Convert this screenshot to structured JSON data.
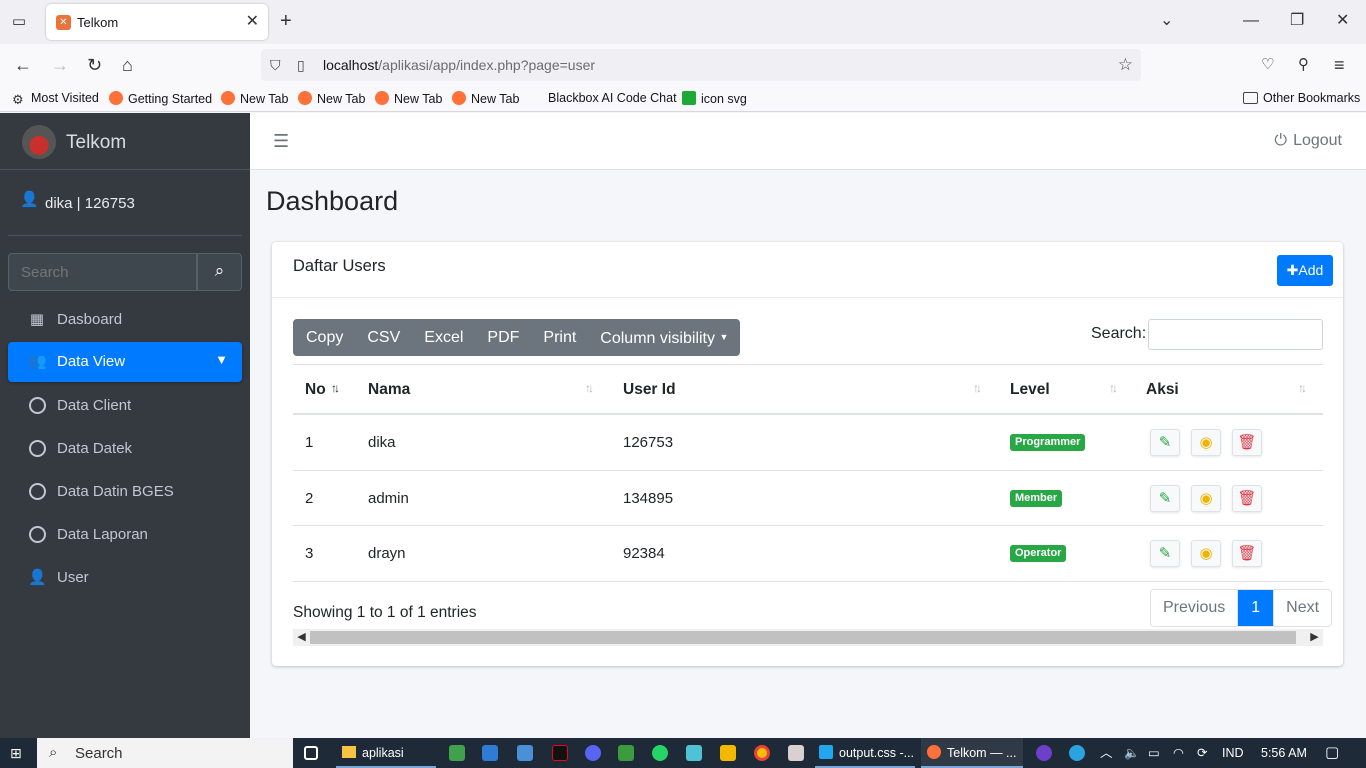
{
  "browser": {
    "tab_title": "Telkom",
    "url_host": "localhost",
    "url_path": "/aplikasi/app/index.php?page=user",
    "bookmarks": [
      "Most Visited",
      "Getting Started",
      "New Tab",
      "New Tab",
      "New Tab",
      "New Tab",
      "Blackbox AI Code Chat",
      "icon svg"
    ],
    "other_bookmarks": "Other Bookmarks"
  },
  "sidebar": {
    "brand": "Telkom",
    "user": "dika | 126753",
    "search_placeholder": "Search",
    "items": [
      {
        "label": "Dasboard",
        "icon": "grid-icon"
      },
      {
        "label": "Data View",
        "icon": "users-icon",
        "active": true
      },
      {
        "label": "Data Client",
        "icon": "circle-icon"
      },
      {
        "label": "Data Datek",
        "icon": "circle-icon"
      },
      {
        "label": "Data Datin BGES",
        "icon": "circle-icon"
      },
      {
        "label": "Data Laporan",
        "icon": "circle-icon"
      },
      {
        "label": "User",
        "icon": "user-icon"
      }
    ]
  },
  "topnav": {
    "logout": "Logout"
  },
  "page": {
    "title": "Dashboard"
  },
  "card": {
    "title": "Daftar Users",
    "add_label": "Add",
    "buttons": [
      "Copy",
      "CSV",
      "Excel",
      "PDF",
      "Print",
      "Column visibility"
    ],
    "search_label": "Search:",
    "columns": [
      "No",
      "Nama",
      "User Id",
      "Level",
      "Aksi"
    ],
    "rows": [
      {
        "no": "1",
        "nama": "dika",
        "user_id": "126753",
        "level": "Programmer"
      },
      {
        "no": "2",
        "nama": "admin",
        "user_id": "134895",
        "level": "Member"
      },
      {
        "no": "3",
        "nama": "drayn",
        "user_id": "92384",
        "level": "Operator"
      }
    ],
    "info": "Showing 1 to 1 of 1 entries",
    "pagination": {
      "previous": "Previous",
      "current": "1",
      "next": "Next"
    }
  },
  "taskbar": {
    "search": "Search",
    "items": [
      "aplikasi",
      "output.css -...",
      "Telkom — ..."
    ],
    "lang": "IND",
    "time": "5:56 AM"
  },
  "colors": {
    "sidebar_bg": "#343a40",
    "primary": "#007bff",
    "success": "#28a745",
    "danger": "#dc3545",
    "warning": "#f0b400"
  }
}
